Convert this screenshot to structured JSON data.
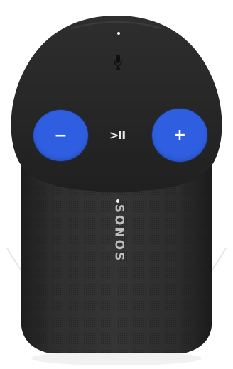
{
  "device": {
    "brand_text": "SONOS",
    "body_color": "#2b2b2b",
    "top_color": "#262626",
    "accent_color": "#2f5fe0"
  },
  "controls": {
    "volume_down_label": "−",
    "volume_up_label": "+",
    "play_pause_label": ">II"
  },
  "icons": {
    "mic": "microphone-icon"
  }
}
